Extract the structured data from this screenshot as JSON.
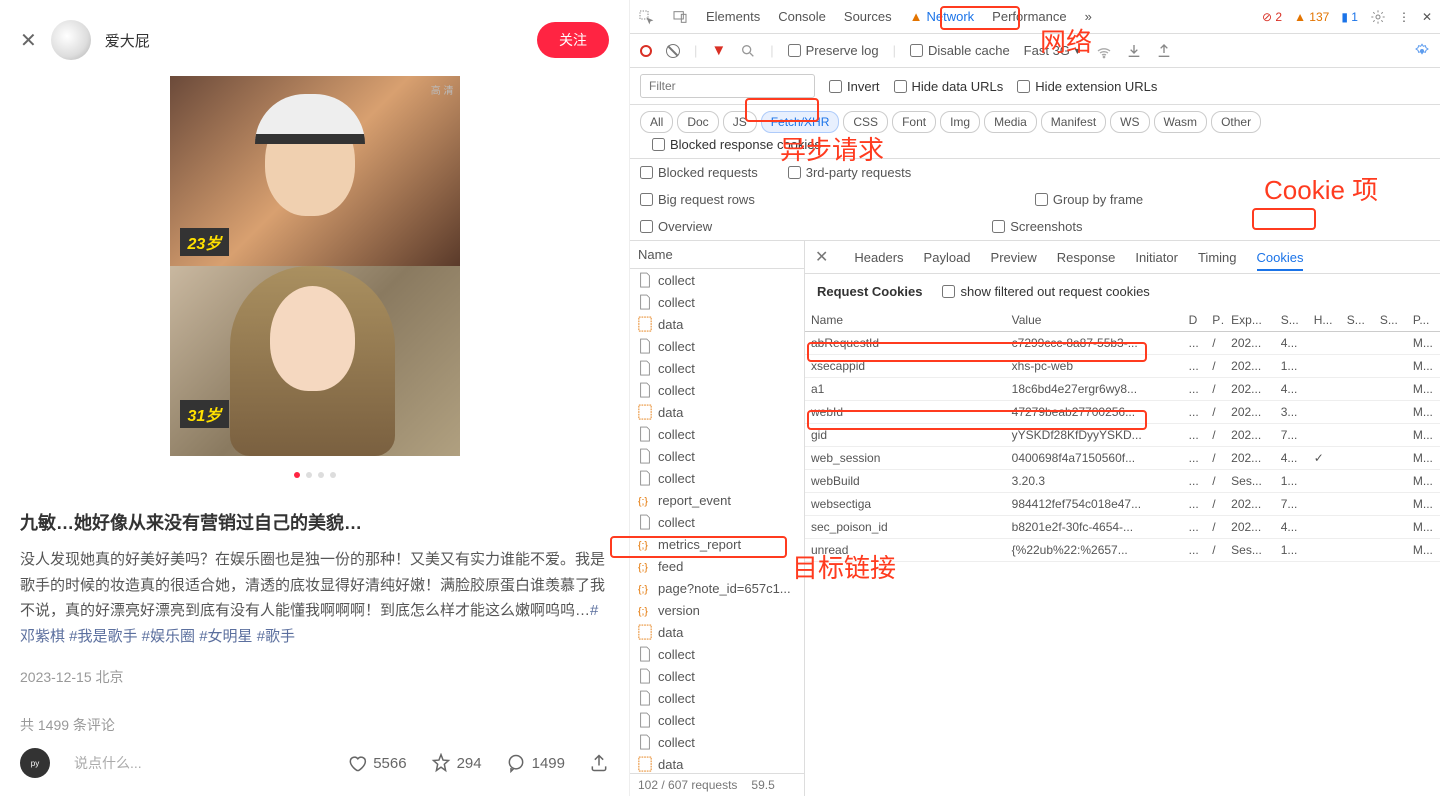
{
  "left": {
    "author": "爱大屁",
    "follow": "关注",
    "age1": "23岁",
    "age2": "31岁",
    "hd": "高 清",
    "title": "九敏…她好像从来没有营销过自己的美貌…",
    "body_pre": "没人发现她真的好美好美吗？在娱乐圈也是独一份的那种！又美又有实力谁能不爱。我是歌手的时候的妆造真的很适合她，清透的底妆显得好清纯好嫩！满脸胶原蛋白谁羡慕了我不说，真的好漂亮好漂亮到底有没有人能懂我啊啊啊！到底怎么样才能这么嫩啊呜呜…",
    "tags": "#邓紫棋 #我是歌手 #娱乐圈 #女明星 #歌手",
    "date": "2023-12-15 北京",
    "comments": "共 1499 条评论",
    "placeholder": "说点什么...",
    "likes": "5566",
    "stars": "294",
    "cm": "1499"
  },
  "devtools": {
    "tabs": [
      "Elements",
      "Console",
      "Sources",
      "Network",
      "Performance"
    ],
    "errors": "2",
    "warnings": "137",
    "info": "1",
    "toolbar": {
      "preserve": "Preserve log",
      "disable": "Disable cache",
      "throttle": "Fast 3G"
    },
    "filter_placeholder": "Filter",
    "filter_checks": {
      "invert": "Invert",
      "hidedata": "Hide data URLs",
      "hideext": "Hide extension URLs"
    },
    "types": [
      "All",
      "Doc",
      "JS",
      "Fetch/XHR",
      "CSS",
      "Font",
      "Img",
      "Media",
      "Manifest",
      "WS",
      "Wasm",
      "Other"
    ],
    "blocked_cookies": "Blocked response cookies",
    "opts": {
      "blockedreq": "Blocked requests",
      "thirdparty": "3rd-party requests",
      "bigrows": "Big request rows",
      "groupframe": "Group by frame",
      "overview": "Overview",
      "screenshots": "Screenshots"
    },
    "name_header": "Name",
    "requests": [
      {
        "n": "collect",
        "t": "doc"
      },
      {
        "n": "collect",
        "t": "doc"
      },
      {
        "n": "data",
        "t": "xhr"
      },
      {
        "n": "collect",
        "t": "doc"
      },
      {
        "n": "collect",
        "t": "doc"
      },
      {
        "n": "collect",
        "t": "doc"
      },
      {
        "n": "data",
        "t": "xhr"
      },
      {
        "n": "collect",
        "t": "doc"
      },
      {
        "n": "collect",
        "t": "doc"
      },
      {
        "n": "collect",
        "t": "doc"
      },
      {
        "n": "report_event",
        "t": "js"
      },
      {
        "n": "collect",
        "t": "doc"
      },
      {
        "n": "metrics_report",
        "t": "js"
      },
      {
        "n": "feed",
        "t": "js"
      },
      {
        "n": "page?note_id=657c1...",
        "t": "js"
      },
      {
        "n": "version",
        "t": "js"
      },
      {
        "n": "data",
        "t": "xhr"
      },
      {
        "n": "collect",
        "t": "doc"
      },
      {
        "n": "collect",
        "t": "doc"
      },
      {
        "n": "collect",
        "t": "doc"
      },
      {
        "n": "collect",
        "t": "doc"
      },
      {
        "n": "collect",
        "t": "doc"
      },
      {
        "n": "data",
        "t": "xhr"
      }
    ],
    "status": {
      "req": "102 / 607 requests",
      "size": "59.5"
    },
    "detail_tabs": [
      "Headers",
      "Payload",
      "Preview",
      "Response",
      "Initiator",
      "Timing",
      "Cookies"
    ],
    "cookies": {
      "title": "Request Cookies",
      "show_filtered": "show filtered out request cookies",
      "cols": [
        "Name",
        "Value",
        "D",
        "P",
        "Exp...",
        "S...",
        "H...",
        "S...",
        "S...",
        "P..."
      ],
      "rows": [
        {
          "name": "abRequestId",
          "value": "c7299ccc-8a87-55b3-...",
          "d": "...",
          "p": "/",
          "e": "202...",
          "s": "4...",
          "h": "",
          "ss": "",
          "sss": "",
          "pp": "M..."
        },
        {
          "name": "xsecappid",
          "value": "xhs-pc-web",
          "d": "...",
          "p": "/",
          "e": "202...",
          "s": "1...",
          "h": "",
          "ss": "",
          "sss": "",
          "pp": "M..."
        },
        {
          "name": "a1",
          "value": "18c6bd4e27ergr6wy8...",
          "d": "...",
          "p": "/",
          "e": "202...",
          "s": "4...",
          "h": "",
          "ss": "",
          "sss": "",
          "pp": "M..."
        },
        {
          "name": "webId",
          "value": "47279beab27700256...",
          "d": "...",
          "p": "/",
          "e": "202...",
          "s": "3...",
          "h": "",
          "ss": "",
          "sss": "",
          "pp": "M..."
        },
        {
          "name": "gid",
          "value": "yYSKDf28KfDyyYSKD...",
          "d": "...",
          "p": "/",
          "e": "202...",
          "s": "7...",
          "h": "",
          "ss": "",
          "sss": "",
          "pp": "M..."
        },
        {
          "name": "web_session",
          "value": "0400698f4a7150560f...",
          "d": "...",
          "p": "/",
          "e": "202...",
          "s": "4...",
          "h": "✓",
          "ss": "",
          "sss": "",
          "pp": "M..."
        },
        {
          "name": "webBuild",
          "value": "3.20.3",
          "d": "...",
          "p": "/",
          "e": "Ses...",
          "s": "1...",
          "h": "",
          "ss": "",
          "sss": "",
          "pp": "M..."
        },
        {
          "name": "websectiga",
          "value": "984412fef754c018e47...",
          "d": "...",
          "p": "/",
          "e": "202...",
          "s": "7...",
          "h": "",
          "ss": "",
          "sss": "",
          "pp": "M..."
        },
        {
          "name": "sec_poison_id",
          "value": "b8201e2f-30fc-4654-...",
          "d": "...",
          "p": "/",
          "e": "202...",
          "s": "4...",
          "h": "",
          "ss": "",
          "sss": "",
          "pp": "M..."
        },
        {
          "name": "unread",
          "value": "{%22ub%22:%2657...",
          "d": "...",
          "p": "/",
          "e": "Ses...",
          "s": "1...",
          "h": "",
          "ss": "",
          "sss": "",
          "pp": "M..."
        }
      ]
    }
  },
  "annotations": {
    "network": "网络",
    "async": "异步请求",
    "cookie": "Cookie 项",
    "target": "目标链接"
  }
}
